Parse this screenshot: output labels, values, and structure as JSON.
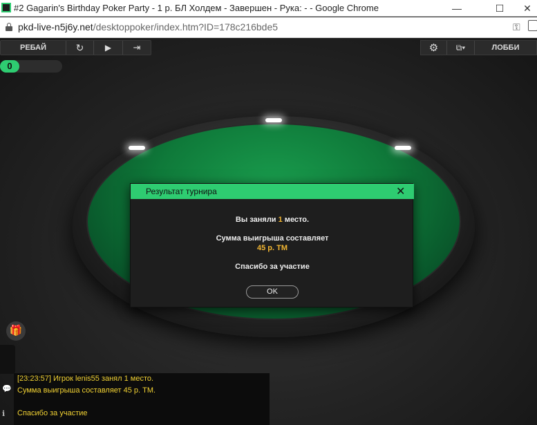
{
  "window": {
    "title": "#2 Gagarin's Birthday Poker Party - 1 р. БЛ Холдем - Завершен - Рука: - - Google Chrome",
    "min_icon": "—",
    "max_icon": "☐",
    "close_icon": "✕"
  },
  "address": {
    "host": "pkd-live-n5j6y.net",
    "path": "/desktoppoker/index.htm?ID=178c216bde5",
    "key_icon": "⚿"
  },
  "toolbar": {
    "rebuy_label": "РЕБАЙ",
    "refresh_icon": "↻",
    "play_icon": "▶",
    "exit_icon": "⇥",
    "gear_icon": "⚙",
    "tables_icon": "⧉▾",
    "lobby_label": "ЛОББИ"
  },
  "counter": "0",
  "modal": {
    "title": "Результат турнира",
    "close_icon": "✕",
    "place_prefix": "Вы заняли ",
    "place_value": "1",
    "place_suffix": " место.",
    "prize_line": "Сумма выигрыша составляет",
    "prize_amount": "45 р. ТМ",
    "thanks": "Спасибо за участие",
    "ok_label": "OK"
  },
  "gift_icon": "🎁",
  "chat": {
    "lines": [
      "[23:23:57] Игрок lenis55 занял 1 место.",
      "Сумма выигрыша составляет 45 р. ТМ.",
      "",
      "Спасибо за участие"
    ],
    "speech_icon": "💬",
    "info_icon": "ℹ"
  },
  "colors": {
    "accent_green": "#2ecc71",
    "prize_gold": "#f2b632",
    "chat_text": "#f2d233"
  }
}
